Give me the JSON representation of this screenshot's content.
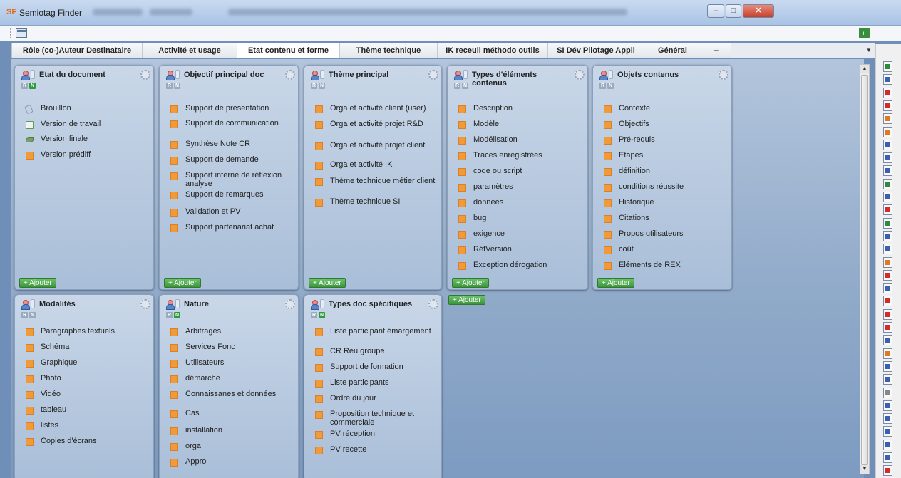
{
  "window": {
    "title": "Semiotag Finder",
    "app_icon": "sf-logo-icon",
    "controls": [
      "minimize",
      "maximize",
      "close"
    ]
  },
  "toolbar": {
    "left_icon": "window-icon",
    "right_icon": "green-tool-icon"
  },
  "tabs": [
    {
      "label": "Rôle (co-)Auteur Destinataire",
      "active": false
    },
    {
      "label": "Activité et usage",
      "active": false
    },
    {
      "label": "Etat contenu et forme",
      "active": true
    },
    {
      "label": "Thème technique",
      "active": false
    },
    {
      "label": "IK receuil méthodo outils",
      "active": false
    },
    {
      "label": "SI Dév Pilotage Appli",
      "active": false
    },
    {
      "label": "Général",
      "active": false
    },
    {
      "label": "+",
      "active": false
    }
  ],
  "panels": [
    {
      "title": "Etat du document",
      "badges": [
        "N"
      ],
      "items": [
        "Brouillon",
        "Version de travail",
        "Version finale",
        "Version prédiff"
      ],
      "item_icons": [
        "draft",
        "work",
        "final",
        "square"
      ],
      "add_label": "+ Ajouter"
    },
    {
      "title": "Objectif principal doc",
      "badges": [
        "R",
        "N"
      ],
      "items": [
        "Support de présentation",
        "Support de communication",
        "Synthèse Note CR",
        "Support de demande",
        "Support interne de réflexion analyse",
        "Support de remarques",
        "Validation et PV",
        "Support partenariat achat"
      ],
      "add_label": "+ Ajouter"
    },
    {
      "title": "Thème principal",
      "badges": [
        "R",
        "N"
      ],
      "items": [
        "Orga et activité client (user)",
        "Orga et activité projet R&D",
        "Orga et activité projet client",
        "Orga et activité IK",
        "Thème technique métier client",
        "Thème technique SI"
      ],
      "add_label": "+ Ajouter"
    },
    {
      "title": "Types d'éléments contenus",
      "badges": [
        "R",
        "N"
      ],
      "items": [
        "Description",
        "Modèle",
        "Modélisation",
        "Traces enregistrées",
        "code ou script",
        "paramètres",
        "données",
        "bug",
        "exigence",
        "RéfVersion",
        "Exception dérogation"
      ],
      "add_label": "+ Ajouter"
    },
    {
      "title": "Objets contenus",
      "badges": [
        "R",
        "N"
      ],
      "items": [
        "Contexte",
        "Objectifs",
        "Pré-requis",
        "Etapes",
        "définition",
        "conditions réussite",
        "Historique",
        "Citations",
        "Propos utilisateurs",
        "coût",
        "Eléments de REX"
      ],
      "add_label": "+ Ajouter"
    },
    {
      "title": "Modalités",
      "badges": [
        "R",
        "N"
      ],
      "items": [
        "Paragraphes textuels",
        "Schéma",
        "Graphique",
        "Photo",
        "Vidéo",
        "tableau",
        "listes",
        "Copies d'écrans"
      ],
      "add_label": ""
    },
    {
      "title": "Nature",
      "badges": [
        "R",
        "N"
      ],
      "items": [
        "Arbitrages",
        "Services Fonc",
        "Utilisateurs",
        "démarche",
        "Connaissanes et données",
        "Cas",
        "installation",
        "orga",
        "Appro"
      ],
      "add_label": ""
    },
    {
      "title": "Types doc spécifiques",
      "badges": [
        "R",
        "N"
      ],
      "items": [
        "Liste participant émargement",
        "CR Réu groupe",
        "Support de formation",
        "Liste participants",
        "Ordre du jour",
        "Proposition technique et commerciale",
        "PV réception",
        "PV recette"
      ],
      "add_label": ""
    }
  ],
  "standalone_add_label": "+ Ajouter",
  "doc_strip_icons": [
    "excel",
    "word",
    "pdf",
    "pdf",
    "ppt",
    "ppt",
    "word",
    "word",
    "word",
    "excel",
    "word",
    "pdf",
    "excel",
    "word",
    "word",
    "ppt",
    "pdf",
    "word",
    "pdf",
    "pdf",
    "pdf",
    "word",
    "ppt",
    "word",
    "word",
    "generic",
    "word",
    "word",
    "word",
    "word",
    "word",
    "pdf"
  ]
}
